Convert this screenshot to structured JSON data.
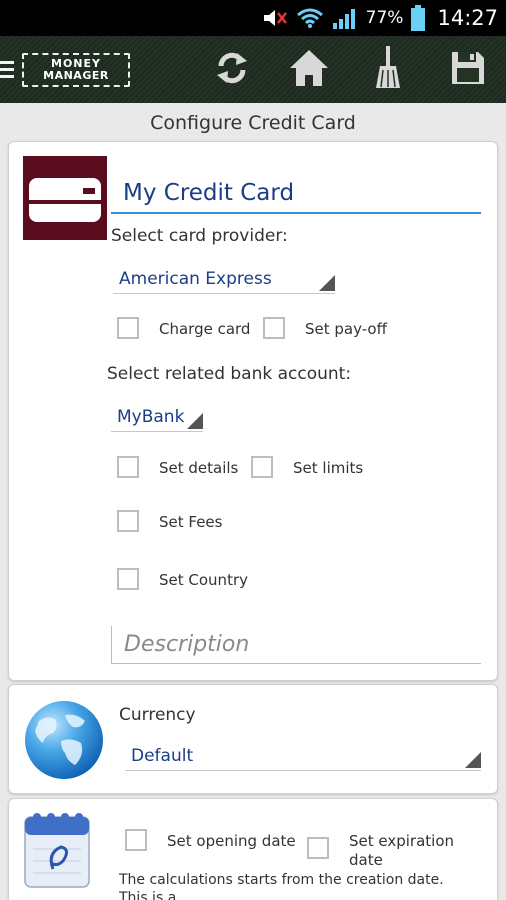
{
  "status_bar": {
    "battery_percent": "77%",
    "time": "14:27",
    "icons": [
      "volume-muted-icon",
      "wifi-icon",
      "signal-icon",
      "battery-icon"
    ]
  },
  "action_bar": {
    "logo_line1": "MONEY",
    "logo_line2": "MANAGER",
    "buttons": [
      "sync-icon",
      "home-icon",
      "broom-icon",
      "save-icon"
    ]
  },
  "page": {
    "title": "Configure Credit Card"
  },
  "card": {
    "name_value": "My Credit Card",
    "provider_label": "Select card provider:",
    "provider_selected": "American Express",
    "charge_card_label": "Charge card",
    "set_payoff_label": "Set pay-off",
    "bank_label": "Select related bank account:",
    "bank_selected": "MyBank",
    "set_details_label": "Set details",
    "set_limits_label": "Set limits",
    "set_fees_label": "Set Fees",
    "set_country_label": "Set Country",
    "description_placeholder": "Description"
  },
  "currency": {
    "label": "Currency",
    "selected": "Default"
  },
  "dates": {
    "opening_label": "Set opening date",
    "expiration_label": "Set expiration date",
    "info_line1": "The calculations starts from the creation date.",
    "info_line2": "This is a...,"
  },
  "colors": {
    "accent": "#3a8ed8",
    "value_text": "#1c3d86",
    "card_icon_bg": "#5a0d1e",
    "action_bar_bg": "#243326"
  }
}
